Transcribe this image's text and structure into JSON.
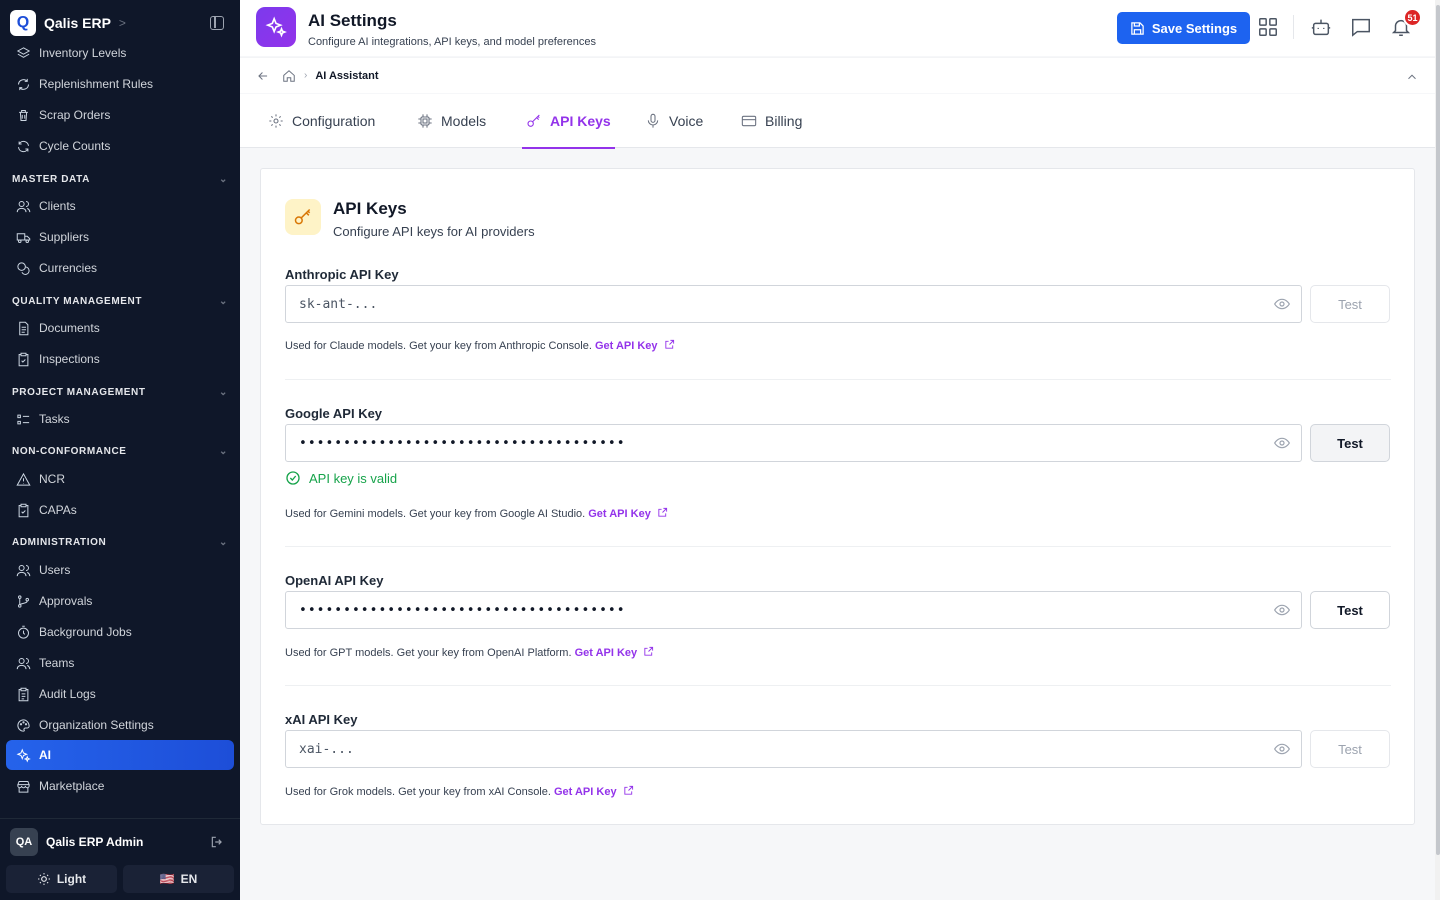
{
  "brand": {
    "logo": "Q",
    "name": "Qalis ERP",
    "chevron": ">"
  },
  "sidebar": {
    "items_top": [
      {
        "label": "Inventory Levels",
        "icon": "layers-icon"
      },
      {
        "label": "Replenishment Rules",
        "icon": "refresh-icon"
      },
      {
        "label": "Scrap Orders",
        "icon": "trash-icon"
      },
      {
        "label": "Cycle Counts",
        "icon": "cycle-icon"
      }
    ],
    "sections": [
      {
        "title": "MASTER DATA",
        "items": [
          "Clients",
          "Suppliers",
          "Currencies"
        ]
      },
      {
        "title": "QUALITY MANAGEMENT",
        "items": [
          "Documents",
          "Inspections"
        ]
      },
      {
        "title": "PROJECT MANAGEMENT",
        "items": [
          "Tasks"
        ]
      },
      {
        "title": "NON-CONFORMANCE",
        "items": [
          "NCR",
          "CAPAs"
        ]
      },
      {
        "title": "ADMINISTRATION",
        "items": [
          "Users",
          "Approvals",
          "Background Jobs",
          "Teams",
          "Audit Logs",
          "Organization Settings",
          "AI",
          "Marketplace"
        ]
      }
    ],
    "user": {
      "initials": "QA",
      "name": "Qalis ERP Admin"
    },
    "theme_label": "Light",
    "language_label": "EN",
    "language_flag": "🇺🇸"
  },
  "header": {
    "title": "AI Settings",
    "subtitle": "Configure AI integrations, API keys, and model preferences",
    "save_label": "Save Settings",
    "notification_count": "51"
  },
  "breadcrumb": {
    "current": "AI Assistant"
  },
  "tabs": [
    {
      "label": "Configuration",
      "active": false
    },
    {
      "label": "Models",
      "active": false
    },
    {
      "label": "API Keys",
      "active": true
    },
    {
      "label": "Voice",
      "active": false
    },
    {
      "label": "Billing",
      "active": false
    }
  ],
  "card": {
    "title": "API Keys",
    "subtitle": "Configure API keys for AI providers"
  },
  "keys": [
    {
      "label": "Anthropic API Key",
      "value": "sk-ant-...",
      "masked": false,
      "test_label": "Test",
      "test_enabled": false,
      "help": "Used for Claude models. Get your key from Anthropic Console.",
      "link": "Get API Key"
    },
    {
      "label": "Google API Key",
      "value": "•••••••••••••••••••••••••••••••••••••",
      "masked": true,
      "test_label": "Test",
      "test_enabled": true,
      "status": "API key is valid",
      "help": "Used for Gemini models. Get your key from Google AI Studio.",
      "link": "Get API Key"
    },
    {
      "label": "OpenAI API Key",
      "value": "•••••••••••••••••••••••••••••••••••••",
      "masked": true,
      "test_label": "Test",
      "test_enabled": true,
      "help": "Used for GPT models. Get your key from OpenAI Platform.",
      "link": "Get API Key"
    },
    {
      "label": "xAI API Key",
      "value": "xai-...",
      "masked": false,
      "test_label": "Test",
      "test_enabled": false,
      "help": "Used for Grok models. Get your key from xAI Console.",
      "link": "Get API Key"
    }
  ],
  "colors": {
    "accent": "#9333ea",
    "primary": "#1d63f0",
    "success": "#16a34a",
    "sidebar_bg": "#0f1729"
  }
}
